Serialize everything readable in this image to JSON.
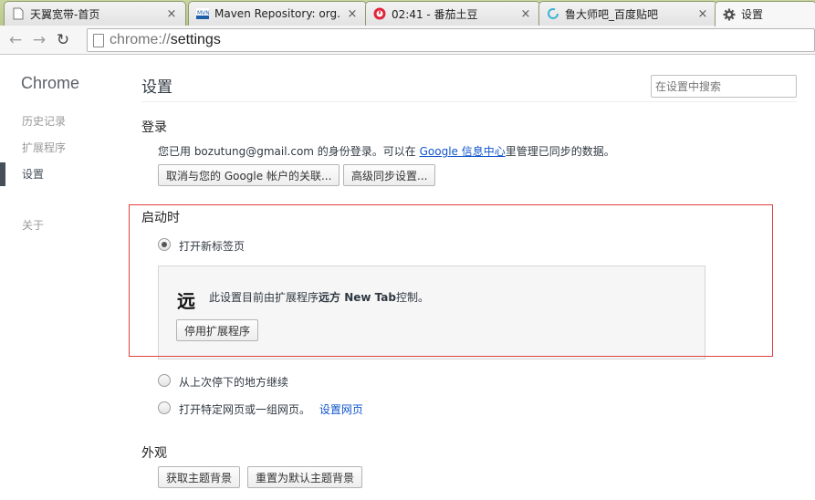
{
  "tabs": [
    {
      "title": "天翼宽带-首页",
      "icon": "page-icon",
      "close": "×"
    },
    {
      "title": "Maven Repository: org.",
      "icon": "mvn-icon",
      "close": "×"
    },
    {
      "title": "02:41 - 番茄土豆",
      "icon": "tomato-icon",
      "close": "×"
    },
    {
      "title": "鲁大师吧_百度贴吧",
      "icon": "loading-icon",
      "close": "×"
    },
    {
      "title": "设置",
      "icon": "gear-icon"
    }
  ],
  "toolbar": {
    "back": "←",
    "forward": "→",
    "reload": "↻",
    "url_scheme": "chrome://",
    "url_path": "settings"
  },
  "sidebar": {
    "brand": "Chrome",
    "items": [
      {
        "label": "历史记录"
      },
      {
        "label": "扩展程序"
      },
      {
        "label": "设置"
      },
      {
        "label": "关于"
      }
    ]
  },
  "main": {
    "title": "设置",
    "search_placeholder": "在设置中搜索",
    "signin": {
      "heading": "登录",
      "text_before": "您已用 bozutung@gmail.com 的身份登录。可以在 ",
      "link": "Google 信息中心",
      "text_after": "里管理已同步的数据。",
      "disconnect_button": "取消与您的 Google 帐户的关联...",
      "advanced_sync_button": "高级同步设置..."
    },
    "startup": {
      "heading": "启动时",
      "option_new_tab": "打开新标签页",
      "ext_notice_before": "此设置目前由扩展程序",
      "ext_name": "远方 New Tab",
      "ext_notice_after": "控制。",
      "ext_logo": "远",
      "disable_button": "停用扩展程序",
      "option_continue": "从上次停下的地方继续",
      "option_specific": "打开特定网页或一组网页。",
      "set_pages_link": "设置网页"
    },
    "appearance": {
      "heading": "外观",
      "get_themes_button": "获取主题背景",
      "reset_theme_button": "重置为默认主题背景"
    }
  },
  "colors": {
    "highlight_box": "#e0403e",
    "link": "#1155cc",
    "tabstrip": "#c9d6a0"
  }
}
